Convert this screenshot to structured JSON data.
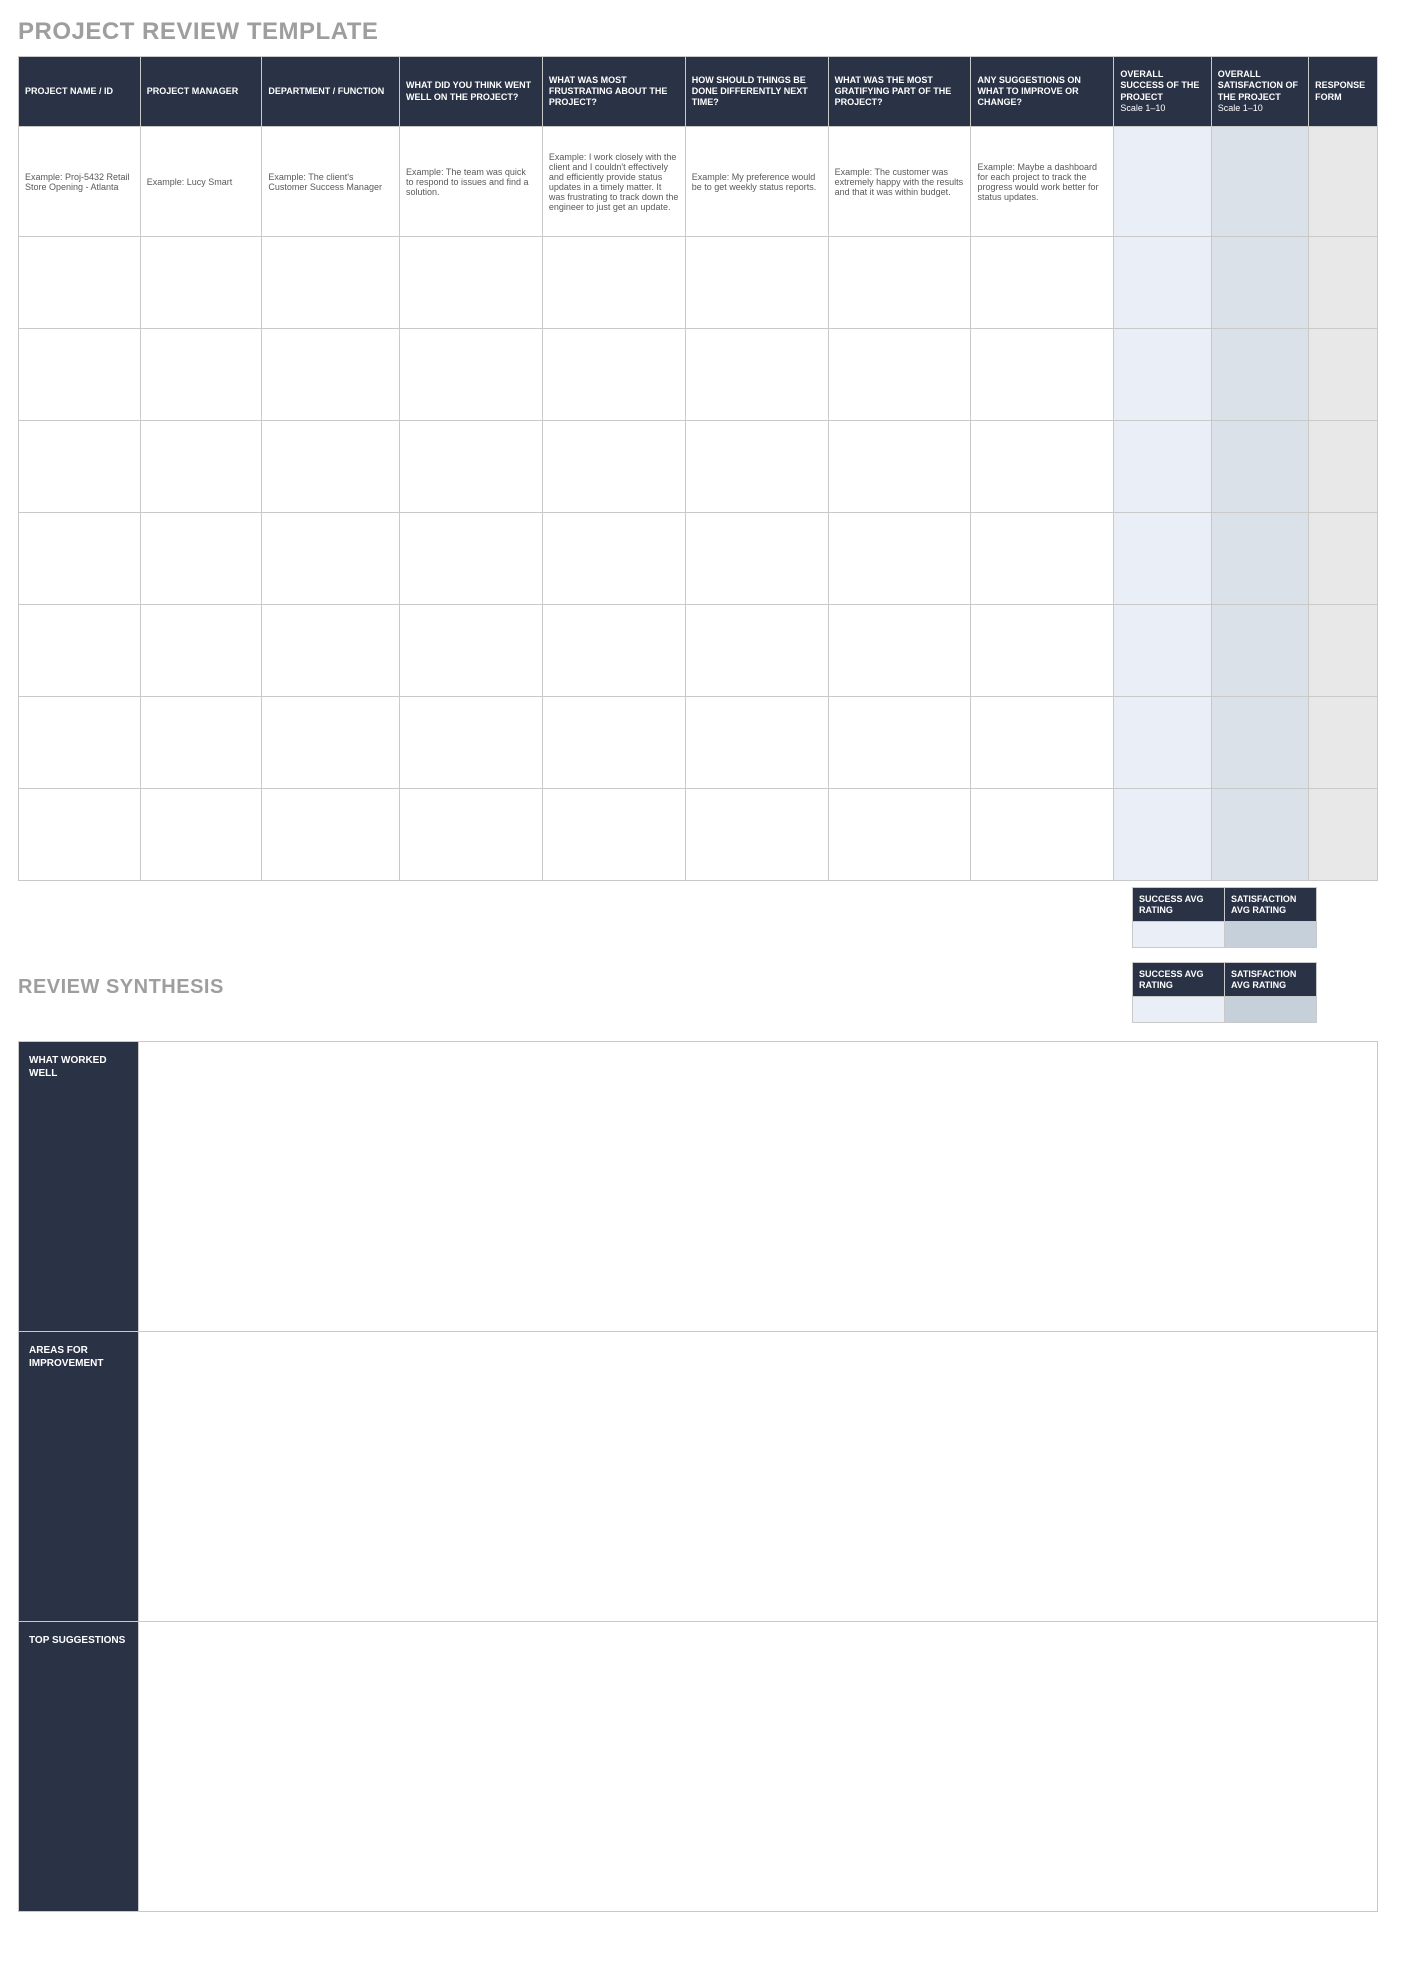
{
  "title": "PROJECT REVIEW TEMPLATE",
  "synthesis_title": "REVIEW SYNTHESIS",
  "headers": {
    "project_name": "PROJECT NAME / ID",
    "project_manager": "PROJECT MANAGER",
    "department": "DEPARTMENT / FUNCTION",
    "went_well": "WHAT DID YOU THINK WENT WELL ON THE PROJECT?",
    "frustrating": "WHAT WAS MOST FRUSTRATING ABOUT THE PROJECT?",
    "differently": "HOW SHOULD THINGS BE DONE DIFFERENTLY NEXT TIME?",
    "gratifying": "WHAT WAS THE MOST GRATIFYING PART OF THE PROJECT?",
    "suggestions": "ANY SUGGESTIONS ON WHAT TO IMPROVE OR CHANGE?",
    "success": "OVERALL SUCCESS OF THE PROJECT",
    "satisfaction": "OVERALL SATISFACTION OF THE PROJECT",
    "scale": "Scale 1–10",
    "response_form": "RESPONSE FORM"
  },
  "example": {
    "project_name": "Example: Proj-5432 Retail Store Opening - Atlanta",
    "project_manager": "Example: Lucy Smart",
    "department": "Example: The client's Customer Success Manager",
    "went_well": "Example: The team was quick to respond to issues and find a solution.",
    "frustrating": "Example: I work closely with the client and I couldn't effectively and efficiently provide status updates in a timely matter. It was frustrating to track down the engineer to just get an update.",
    "differently": "Example: My preference would be to get weekly status reports.",
    "gratifying": "Example: The customer was extremely happy with the results and that it was within budget.",
    "suggestions": "Example: Maybe a dashboard for each project to track the progress would work better for status updates."
  },
  "avg_labels": {
    "success": "SUCCESS AVG RATING",
    "satisfaction": "SATISFACTION AVG RATING"
  },
  "synthesis": {
    "worked_well": "WHAT WORKED WELL",
    "areas_improvement": "AREAS FOR IMPROVEMENT",
    "top_suggestions": "TOP SUGGESTIONS"
  }
}
